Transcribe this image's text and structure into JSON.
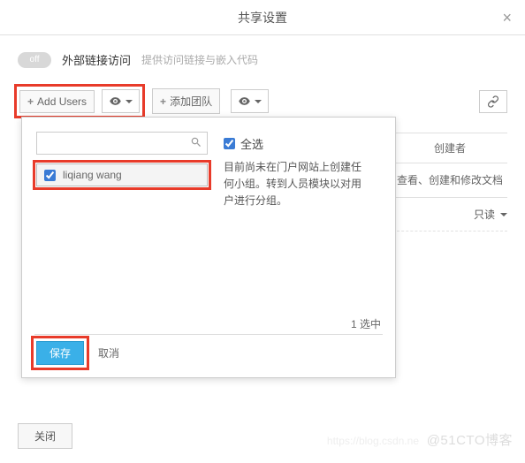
{
  "dialog": {
    "title": "共享设置",
    "close": "×"
  },
  "external": {
    "toggle": "off",
    "label": "外部链接访问",
    "hint": "提供访问链接与嵌入代码"
  },
  "toolbar": {
    "add_users": "Add Users",
    "add_team": "添加团队"
  },
  "right": {
    "header": "创建者",
    "desc": "查看、创建和修改文档",
    "perm": "只读"
  },
  "popup": {
    "search_placeholder": "",
    "select_all": "全选",
    "info": "目前尚未在门户网站上创建任何小组。转到人员模块以对用户进行分组。",
    "user": "liqiang wang",
    "selected_count": "1 选中",
    "save": "保存",
    "cancel": "取消"
  },
  "footer": {
    "close": "关闭"
  },
  "watermark": {
    "a": "https://blog.csdn.ne",
    "b": "@51CTO博客"
  }
}
